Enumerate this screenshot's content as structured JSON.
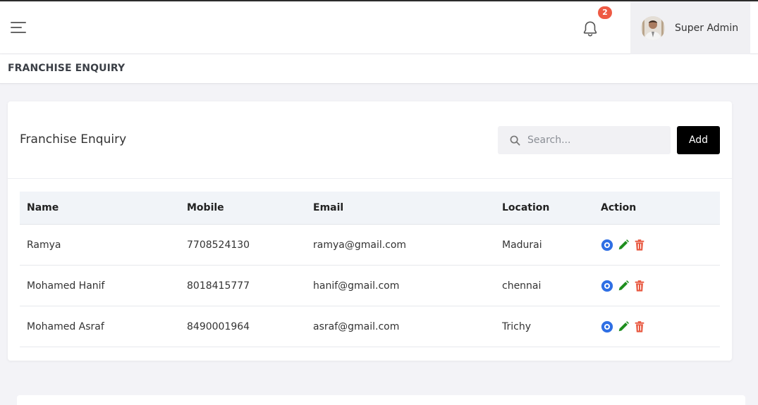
{
  "header": {
    "notification_count": "2",
    "user_name": "Super Admin"
  },
  "page": {
    "title": "FRANCHISE ENQUIRY"
  },
  "card": {
    "title": "Franchise Enquiry",
    "search_placeholder": "Search...",
    "add_label": "Add"
  },
  "table": {
    "columns": [
      "Name",
      "Mobile",
      "Email",
      "Location",
      "Action"
    ],
    "rows": [
      {
        "name": "Ramya",
        "mobile": "7708524130",
        "email": "ramya@gmail.com",
        "location": "Madurai"
      },
      {
        "name": "Mohamed Hanif",
        "mobile": "8018415777",
        "email": "hanif@gmail.com",
        "location": "chennai"
      },
      {
        "name": "Mohamed Asraf",
        "mobile": "8490001964",
        "email": "asraf@gmail.com",
        "location": "Trichy"
      }
    ]
  },
  "icons": {
    "menu": "hamburger-menu-icon",
    "bell": "bell-icon",
    "search": "search-icon",
    "view": "eye-icon",
    "edit": "pencil-icon",
    "delete": "trash-icon"
  },
  "colors": {
    "badge": "#ee5a44",
    "view": "#2f6fe4",
    "edit": "#1e8e1e",
    "delete": "#e8573f",
    "add_button": "#000000"
  }
}
